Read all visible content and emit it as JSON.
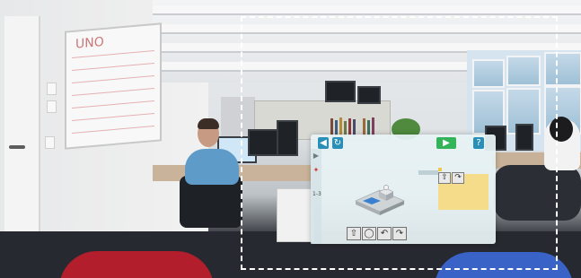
{
  "scene": {
    "whiteboard_heading": "UNO",
    "colors": {
      "panel_bg": "#e8f2f4",
      "toolbar_blue": "#2a8fb7",
      "run_green": "#33b35a",
      "function_area": "#f4dc8a",
      "chair_red": "#b21e2c",
      "chair_blue": "#3a63c8"
    }
  },
  "panel": {
    "level_label": "1-3",
    "toolbar": {
      "back_icon": "◀",
      "reload_icon": "↻",
      "run_icon": "▶",
      "help_icon": "?"
    },
    "side": {
      "play_icon": "▶",
      "bulb_icon": "✦"
    },
    "function_slots": [
      "⇧",
      "↷"
    ],
    "commands": [
      "⇧",
      "◯",
      "↶",
      "↷"
    ]
  }
}
